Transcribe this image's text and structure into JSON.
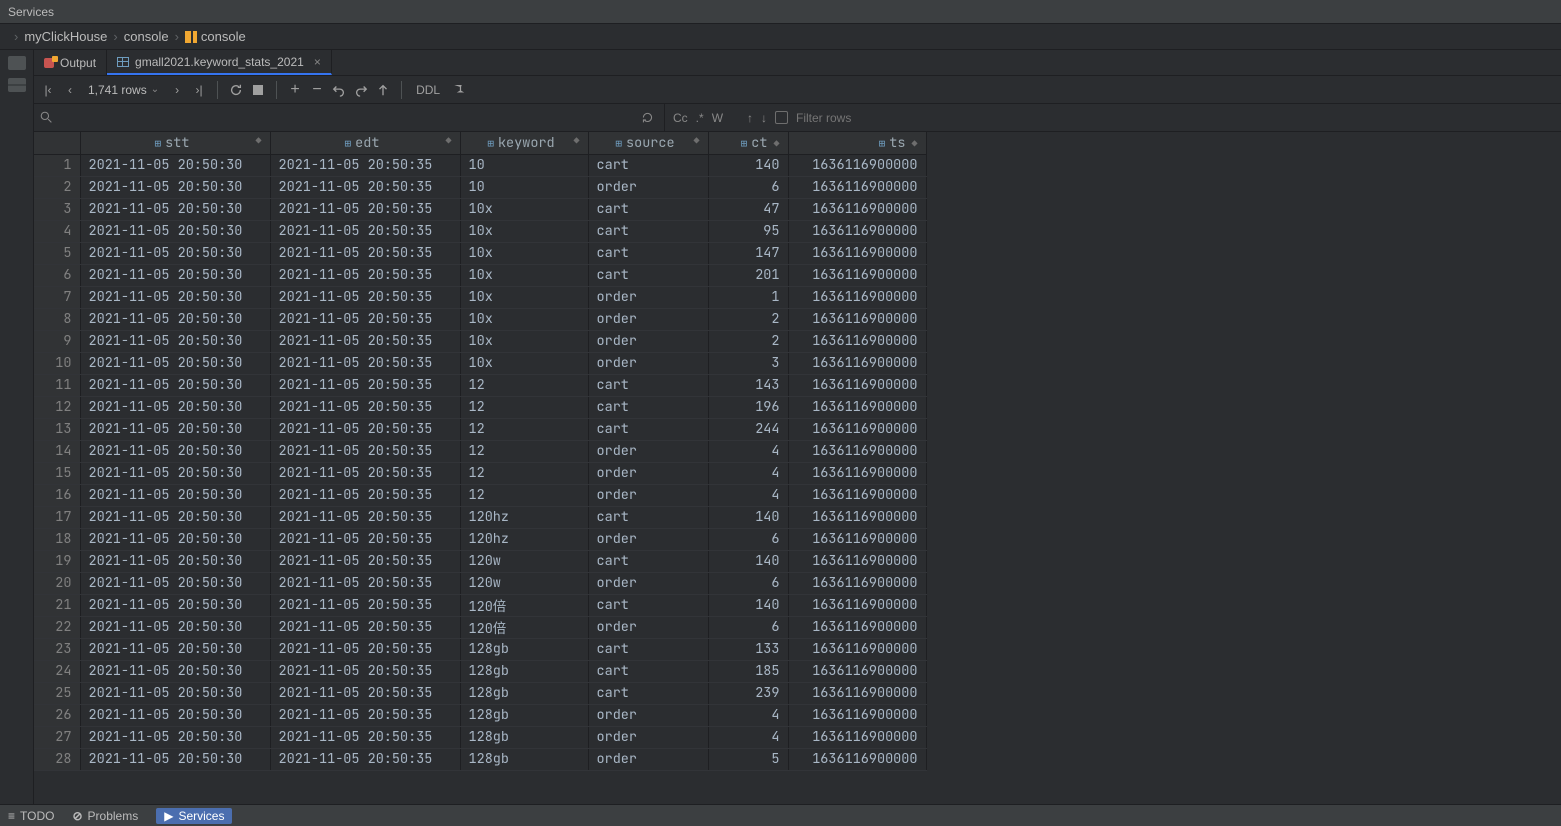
{
  "window": {
    "title": "Services"
  },
  "breadcrumb": {
    "items": [
      "myClickHouse",
      "console",
      "console"
    ]
  },
  "tabs": {
    "output": {
      "label": "Output"
    },
    "active": {
      "label": "gmall2021.keyword_stats_2021"
    }
  },
  "toolbar": {
    "rowcount": "1,741 rows",
    "ddl": "DDL"
  },
  "filter": {
    "cc": "Cc",
    "regex": ".*",
    "word": "W",
    "placeholder": "Filter rows"
  },
  "columns": [
    "stt",
    "edt",
    "keyword",
    "source",
    "ct",
    "ts"
  ],
  "rows": [
    {
      "n": 1,
      "stt": "2021-11-05 20:50:30",
      "edt": "2021-11-05 20:50:35",
      "keyword": "10",
      "source": "cart",
      "ct": 140,
      "ts": 1636116900000
    },
    {
      "n": 2,
      "stt": "2021-11-05 20:50:30",
      "edt": "2021-11-05 20:50:35",
      "keyword": "10",
      "source": "order",
      "ct": 6,
      "ts": 1636116900000
    },
    {
      "n": 3,
      "stt": "2021-11-05 20:50:30",
      "edt": "2021-11-05 20:50:35",
      "keyword": "10x",
      "source": "cart",
      "ct": 47,
      "ts": 1636116900000
    },
    {
      "n": 4,
      "stt": "2021-11-05 20:50:30",
      "edt": "2021-11-05 20:50:35",
      "keyword": "10x",
      "source": "cart",
      "ct": 95,
      "ts": 1636116900000
    },
    {
      "n": 5,
      "stt": "2021-11-05 20:50:30",
      "edt": "2021-11-05 20:50:35",
      "keyword": "10x",
      "source": "cart",
      "ct": 147,
      "ts": 1636116900000
    },
    {
      "n": 6,
      "stt": "2021-11-05 20:50:30",
      "edt": "2021-11-05 20:50:35",
      "keyword": "10x",
      "source": "cart",
      "ct": 201,
      "ts": 1636116900000
    },
    {
      "n": 7,
      "stt": "2021-11-05 20:50:30",
      "edt": "2021-11-05 20:50:35",
      "keyword": "10x",
      "source": "order",
      "ct": 1,
      "ts": 1636116900000
    },
    {
      "n": 8,
      "stt": "2021-11-05 20:50:30",
      "edt": "2021-11-05 20:50:35",
      "keyword": "10x",
      "source": "order",
      "ct": 2,
      "ts": 1636116900000
    },
    {
      "n": 9,
      "stt": "2021-11-05 20:50:30",
      "edt": "2021-11-05 20:50:35",
      "keyword": "10x",
      "source": "order",
      "ct": 2,
      "ts": 1636116900000
    },
    {
      "n": 10,
      "stt": "2021-11-05 20:50:30",
      "edt": "2021-11-05 20:50:35",
      "keyword": "10x",
      "source": "order",
      "ct": 3,
      "ts": 1636116900000
    },
    {
      "n": 11,
      "stt": "2021-11-05 20:50:30",
      "edt": "2021-11-05 20:50:35",
      "keyword": "12",
      "source": "cart",
      "ct": 143,
      "ts": 1636116900000
    },
    {
      "n": 12,
      "stt": "2021-11-05 20:50:30",
      "edt": "2021-11-05 20:50:35",
      "keyword": "12",
      "source": "cart",
      "ct": 196,
      "ts": 1636116900000
    },
    {
      "n": 13,
      "stt": "2021-11-05 20:50:30",
      "edt": "2021-11-05 20:50:35",
      "keyword": "12",
      "source": "cart",
      "ct": 244,
      "ts": 1636116900000
    },
    {
      "n": 14,
      "stt": "2021-11-05 20:50:30",
      "edt": "2021-11-05 20:50:35",
      "keyword": "12",
      "source": "order",
      "ct": 4,
      "ts": 1636116900000
    },
    {
      "n": 15,
      "stt": "2021-11-05 20:50:30",
      "edt": "2021-11-05 20:50:35",
      "keyword": "12",
      "source": "order",
      "ct": 4,
      "ts": 1636116900000
    },
    {
      "n": 16,
      "stt": "2021-11-05 20:50:30",
      "edt": "2021-11-05 20:50:35",
      "keyword": "12",
      "source": "order",
      "ct": 4,
      "ts": 1636116900000
    },
    {
      "n": 17,
      "stt": "2021-11-05 20:50:30",
      "edt": "2021-11-05 20:50:35",
      "keyword": "120hz",
      "source": "cart",
      "ct": 140,
      "ts": 1636116900000
    },
    {
      "n": 18,
      "stt": "2021-11-05 20:50:30",
      "edt": "2021-11-05 20:50:35",
      "keyword": "120hz",
      "source": "order",
      "ct": 6,
      "ts": 1636116900000
    },
    {
      "n": 19,
      "stt": "2021-11-05 20:50:30",
      "edt": "2021-11-05 20:50:35",
      "keyword": "120w",
      "source": "cart",
      "ct": 140,
      "ts": 1636116900000
    },
    {
      "n": 20,
      "stt": "2021-11-05 20:50:30",
      "edt": "2021-11-05 20:50:35",
      "keyword": "120w",
      "source": "order",
      "ct": 6,
      "ts": 1636116900000
    },
    {
      "n": 21,
      "stt": "2021-11-05 20:50:30",
      "edt": "2021-11-05 20:50:35",
      "keyword": "120倍",
      "source": "cart",
      "ct": 140,
      "ts": 1636116900000
    },
    {
      "n": 22,
      "stt": "2021-11-05 20:50:30",
      "edt": "2021-11-05 20:50:35",
      "keyword": "120倍",
      "source": "order",
      "ct": 6,
      "ts": 1636116900000
    },
    {
      "n": 23,
      "stt": "2021-11-05 20:50:30",
      "edt": "2021-11-05 20:50:35",
      "keyword": "128gb",
      "source": "cart",
      "ct": 133,
      "ts": 1636116900000
    },
    {
      "n": 24,
      "stt": "2021-11-05 20:50:30",
      "edt": "2021-11-05 20:50:35",
      "keyword": "128gb",
      "source": "cart",
      "ct": 185,
      "ts": 1636116900000
    },
    {
      "n": 25,
      "stt": "2021-11-05 20:50:30",
      "edt": "2021-11-05 20:50:35",
      "keyword": "128gb",
      "source": "cart",
      "ct": 239,
      "ts": 1636116900000
    },
    {
      "n": 26,
      "stt": "2021-11-05 20:50:30",
      "edt": "2021-11-05 20:50:35",
      "keyword": "128gb",
      "source": "order",
      "ct": 4,
      "ts": 1636116900000
    },
    {
      "n": 27,
      "stt": "2021-11-05 20:50:30",
      "edt": "2021-11-05 20:50:35",
      "keyword": "128gb",
      "source": "order",
      "ct": 4,
      "ts": 1636116900000
    },
    {
      "n": 28,
      "stt": "2021-11-05 20:50:30",
      "edt": "2021-11-05 20:50:35",
      "keyword": "128gb",
      "source": "order",
      "ct": 5,
      "ts": 1636116900000
    }
  ],
  "statusbar": {
    "todo": "TODO",
    "problems": "Problems",
    "services": "Services"
  }
}
